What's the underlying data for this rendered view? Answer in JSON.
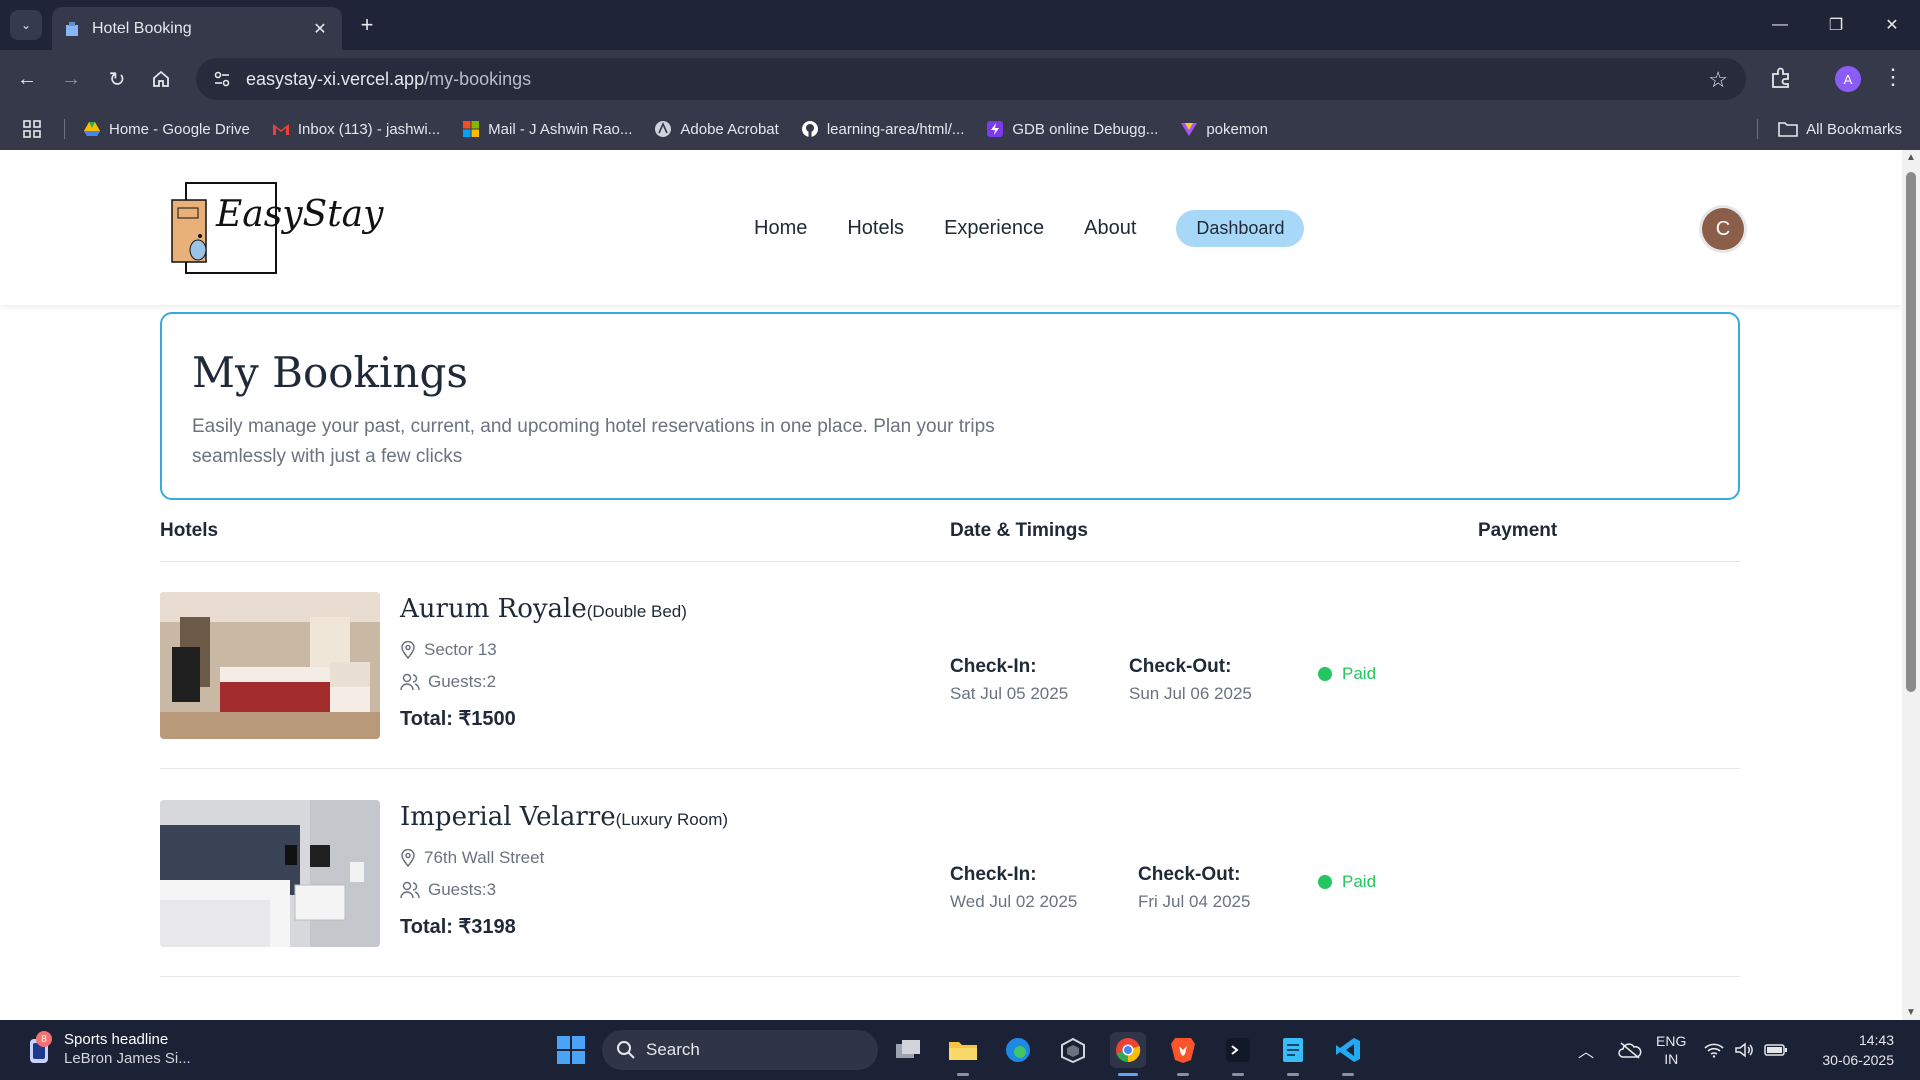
{
  "browser": {
    "tab_title": "Hotel Booking",
    "tab_close": "✕",
    "new_tab": "+",
    "url_domain": "easystay-xi.vercel.app",
    "url_path": "/my-bookings",
    "profile_initial": "A",
    "bookmarks": [
      {
        "label": "Home - Google Drive",
        "icon": "google-drive-icon",
        "color": "#34a853"
      },
      {
        "label": "Inbox (113) - jashwi...",
        "icon": "gmail-icon",
        "color": "#ea4335"
      },
      {
        "label": "Mail - J Ashwin Rao...",
        "icon": "microsoft-icon",
        "color": "#f25022"
      },
      {
        "label": "Adobe Acrobat",
        "icon": "acrobat-icon",
        "color": "#cccccc"
      },
      {
        "label": "learning-area/html/...",
        "icon": "github-icon",
        "color": "#ffffff"
      },
      {
        "label": "GDB online Debugg...",
        "icon": "gdb-icon",
        "color": "#7c3aed"
      },
      {
        "label": "pokemon",
        "icon": "pokemon-icon",
        "color": "#a855f7"
      }
    ],
    "all_bookmarks": "All Bookmarks"
  },
  "site": {
    "logo_text": "EasyStay",
    "nav": [
      "Home",
      "Hotels",
      "Experience",
      "About"
    ],
    "dashboard_label": "Dashboard",
    "avatar_initial": "C"
  },
  "hero": {
    "title": "My Bookings",
    "description": "Easily manage your past, current, and upcoming hotel reservations in one place. Plan your trips seamlessly with just a few clicks"
  },
  "columns": {
    "hotels": "Hotels",
    "dates": "Date & Timings",
    "payment": "Payment"
  },
  "bookings": [
    {
      "name": "Aurum Royale",
      "room": "(Double Bed)",
      "location": "Sector 13",
      "guests": "Guests:2",
      "total": "Total: ₹1500",
      "checkin_label": "Check-In:",
      "checkin": "Sat Jul 05 2025",
      "checkout_label": "Check-Out:",
      "checkout": "Sun Jul 06 2025",
      "payment": "Paid"
    },
    {
      "name": "Imperial Velarre",
      "room": "(Luxury Room)",
      "location": "76th Wall Street",
      "guests": "Guests:3",
      "total": "Total: ₹3198",
      "checkin_label": "Check-In:",
      "checkin": "Wed Jul 02 2025",
      "checkout_label": "Check-Out:",
      "checkout": "Fri Jul 04 2025",
      "payment": "Paid"
    }
  ],
  "taskbar": {
    "news_badge": "8",
    "news_title": "Sports headline",
    "news_sub": "LeBron James Si...",
    "search_label": "Search",
    "lang_top": "ENG",
    "lang_bottom": "IN",
    "time": "14:43",
    "date": "30-06-2025"
  },
  "colors": {
    "accent": "#38a8e0",
    "dashboard": "#a8d8f8",
    "paid": "#22c55e"
  }
}
